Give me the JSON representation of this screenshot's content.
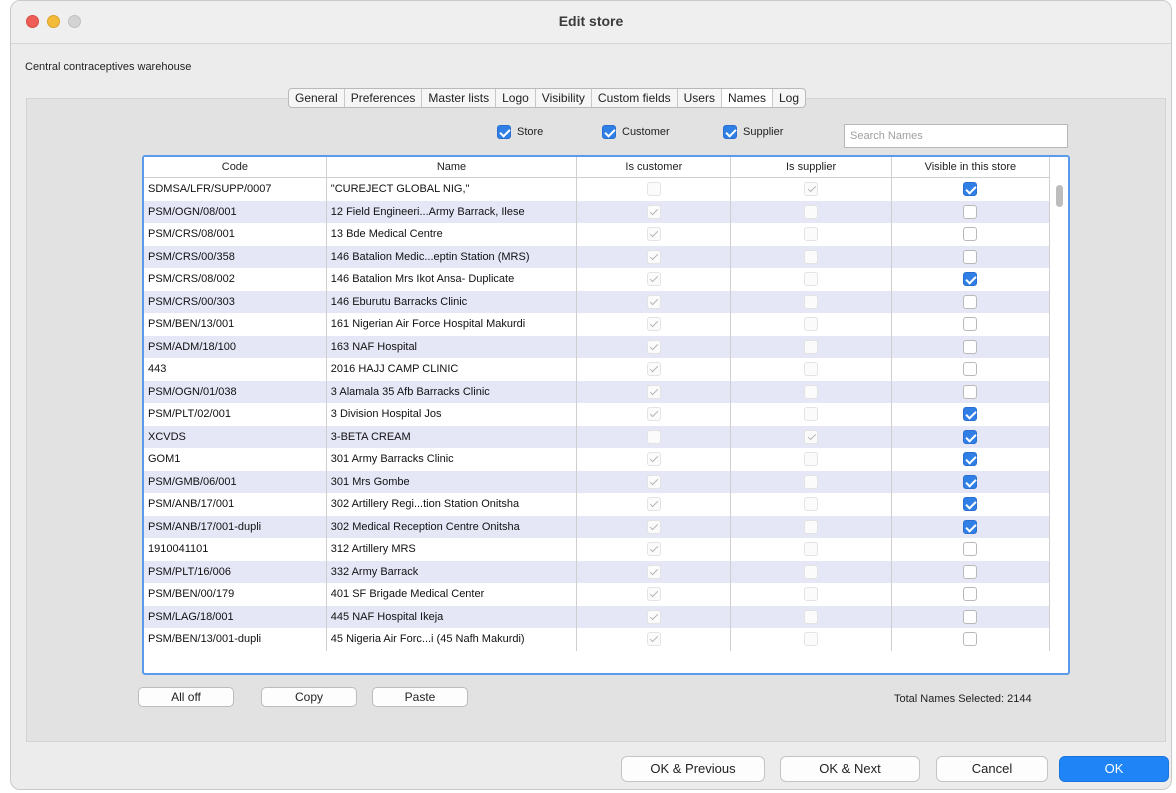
{
  "window": {
    "title": "Edit store"
  },
  "store_name": "Central contraceptives warehouse",
  "tabs": [
    "General",
    "Preferences",
    "Master lists",
    "Logo",
    "Visibility",
    "Custom fields",
    "Users",
    "Names",
    "Log"
  ],
  "active_tab": "Names",
  "filters": {
    "store": "Store",
    "customer": "Customer",
    "supplier": "Supplier"
  },
  "search": {
    "placeholder": "Search Names",
    "value": ""
  },
  "table": {
    "headers": {
      "code": "Code",
      "name": "Name",
      "is_customer": "Is customer",
      "is_supplier": "Is supplier",
      "visible": "Visible in this store"
    },
    "rows": [
      {
        "code": "SDMSA/LFR/SUPP/0007",
        "name": "\"CUREJECT GLOBAL NIG,\"",
        "cust": false,
        "supp": true,
        "vis": true
      },
      {
        "code": "PSM/OGN/08/001",
        "name": "12 Field Engineeri...Army Barrack, Ilese",
        "cust": true,
        "supp": false,
        "vis": false
      },
      {
        "code": "PSM/CRS/08/001",
        "name": "13 Bde Medical Centre",
        "cust": true,
        "supp": false,
        "vis": false
      },
      {
        "code": "PSM/CRS/00/358",
        "name": "146 Batalion Medic...eptin Station (MRS)",
        "cust": true,
        "supp": false,
        "vis": false
      },
      {
        "code": "PSM/CRS/08/002",
        "name": "146 Batalion Mrs Ikot Ansa- Duplicate",
        "cust": true,
        "supp": false,
        "vis": true
      },
      {
        "code": "PSM/CRS/00/303",
        "name": "146 Eburutu Barracks Clinic",
        "cust": true,
        "supp": false,
        "vis": false
      },
      {
        "code": "PSM/BEN/13/001",
        "name": "161 Nigerian Air Force Hospital Makurdi",
        "cust": true,
        "supp": false,
        "vis": false
      },
      {
        "code": "PSM/ADM/18/100",
        "name": "163 NAF Hospital",
        "cust": true,
        "supp": false,
        "vis": false
      },
      {
        "code": "443",
        "name": "2016 HAJJ CAMP CLINIC",
        "cust": true,
        "supp": false,
        "vis": false
      },
      {
        "code": "PSM/OGN/01/038",
        "name": "3 Alamala 35 Afb Barracks Clinic",
        "cust": true,
        "supp": false,
        "vis": false
      },
      {
        "code": "PSM/PLT/02/001",
        "name": "3 Division Hospital Jos",
        "cust": true,
        "supp": false,
        "vis": true
      },
      {
        "code": "XCVDS",
        "name": "3-BETA CREAM",
        "cust": false,
        "supp": true,
        "vis": true
      },
      {
        "code": "GOM1",
        "name": "301 Army Barracks Clinic",
        "cust": true,
        "supp": false,
        "vis": true
      },
      {
        "code": "PSM/GMB/06/001",
        "name": "301 Mrs Gombe",
        "cust": true,
        "supp": false,
        "vis": true
      },
      {
        "code": "PSM/ANB/17/001",
        "name": "302 Artillery Regi...tion Station Onitsha",
        "cust": true,
        "supp": false,
        "vis": true
      },
      {
        "code": "PSM/ANB/17/001-dupli",
        "name": "302 Medical Reception Centre Onitsha",
        "cust": true,
        "supp": false,
        "vis": true
      },
      {
        "code": "1910041101",
        "name": "312 Artillery MRS",
        "cust": true,
        "supp": false,
        "vis": false
      },
      {
        "code": "PSM/PLT/16/006",
        "name": "332 Army Barrack",
        "cust": true,
        "supp": false,
        "vis": false
      },
      {
        "code": "PSM/BEN/00/179",
        "name": "401 SF Brigade Medical Center",
        "cust": true,
        "supp": false,
        "vis": false
      },
      {
        "code": "PSM/LAG/18/001",
        "name": "445 NAF Hospital Ikeja",
        "cust": true,
        "supp": false,
        "vis": false
      },
      {
        "code": "PSM/BEN/13/001-dupli",
        "name": "45 Nigeria Air Forc...i (45 Nafh Makurdi)",
        "cust": true,
        "supp": false,
        "vis": false
      }
    ]
  },
  "actions": {
    "all_off": "All off",
    "copy": "Copy",
    "paste": "Paste"
  },
  "total": {
    "label": "Total Names Selected:",
    "value": "2144"
  },
  "footer": {
    "ok_prev": "OK & Previous",
    "ok_next": "OK & Next",
    "cancel": "Cancel",
    "ok": "OK"
  },
  "colors": {
    "accent": "#1f84f5",
    "row_alt": "#e5e7f7",
    "table_border": "#5b9bea"
  }
}
